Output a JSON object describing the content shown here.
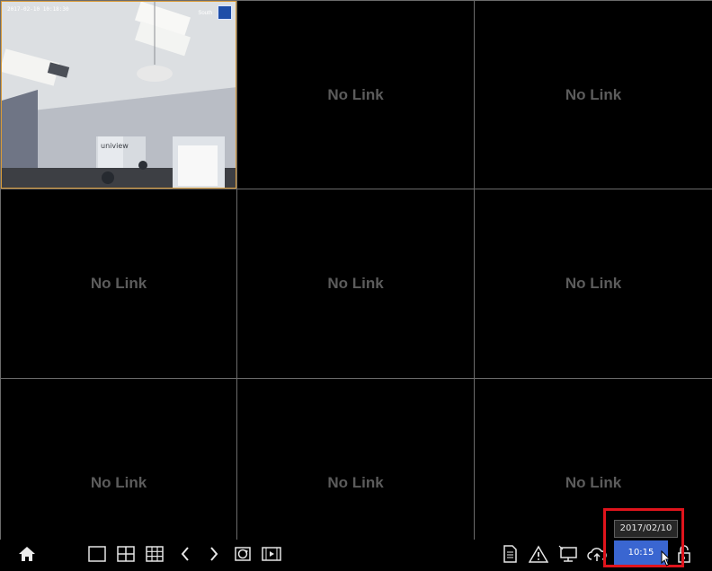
{
  "channels": [
    {
      "state": "live",
      "osd_time": "2017-02-10 10:18:30",
      "osd_label": "South"
    },
    {
      "state": "empty",
      "label": "No Link"
    },
    {
      "state": "empty",
      "label": "No Link"
    },
    {
      "state": "empty",
      "label": "No Link"
    },
    {
      "state": "empty",
      "label": "No Link"
    },
    {
      "state": "empty",
      "label": "No Link"
    },
    {
      "state": "empty",
      "label": "No Link"
    },
    {
      "state": "empty",
      "label": "No Link"
    },
    {
      "state": "empty",
      "label": "No Link"
    }
  ],
  "live_view_scene": {
    "camera_brand_text": "uniview"
  },
  "toolbar": {
    "left": [
      "home-icon",
      "layout-1-icon",
      "layout-4-icon",
      "layout-9-icon",
      "prev-screen-icon",
      "next-screen-icon",
      "sequence-icon",
      "playback-icon"
    ],
    "right": [
      "log-icon",
      "alarm-icon",
      "network-icon",
      "cloud-upload-icon",
      "lock-icon"
    ]
  },
  "clock": {
    "date": "2017/02/10",
    "time": "10:15"
  },
  "colors": {
    "accent": "#3a66d1",
    "highlight_frame": "#e0141c",
    "selected_border": "#d89b3a"
  }
}
